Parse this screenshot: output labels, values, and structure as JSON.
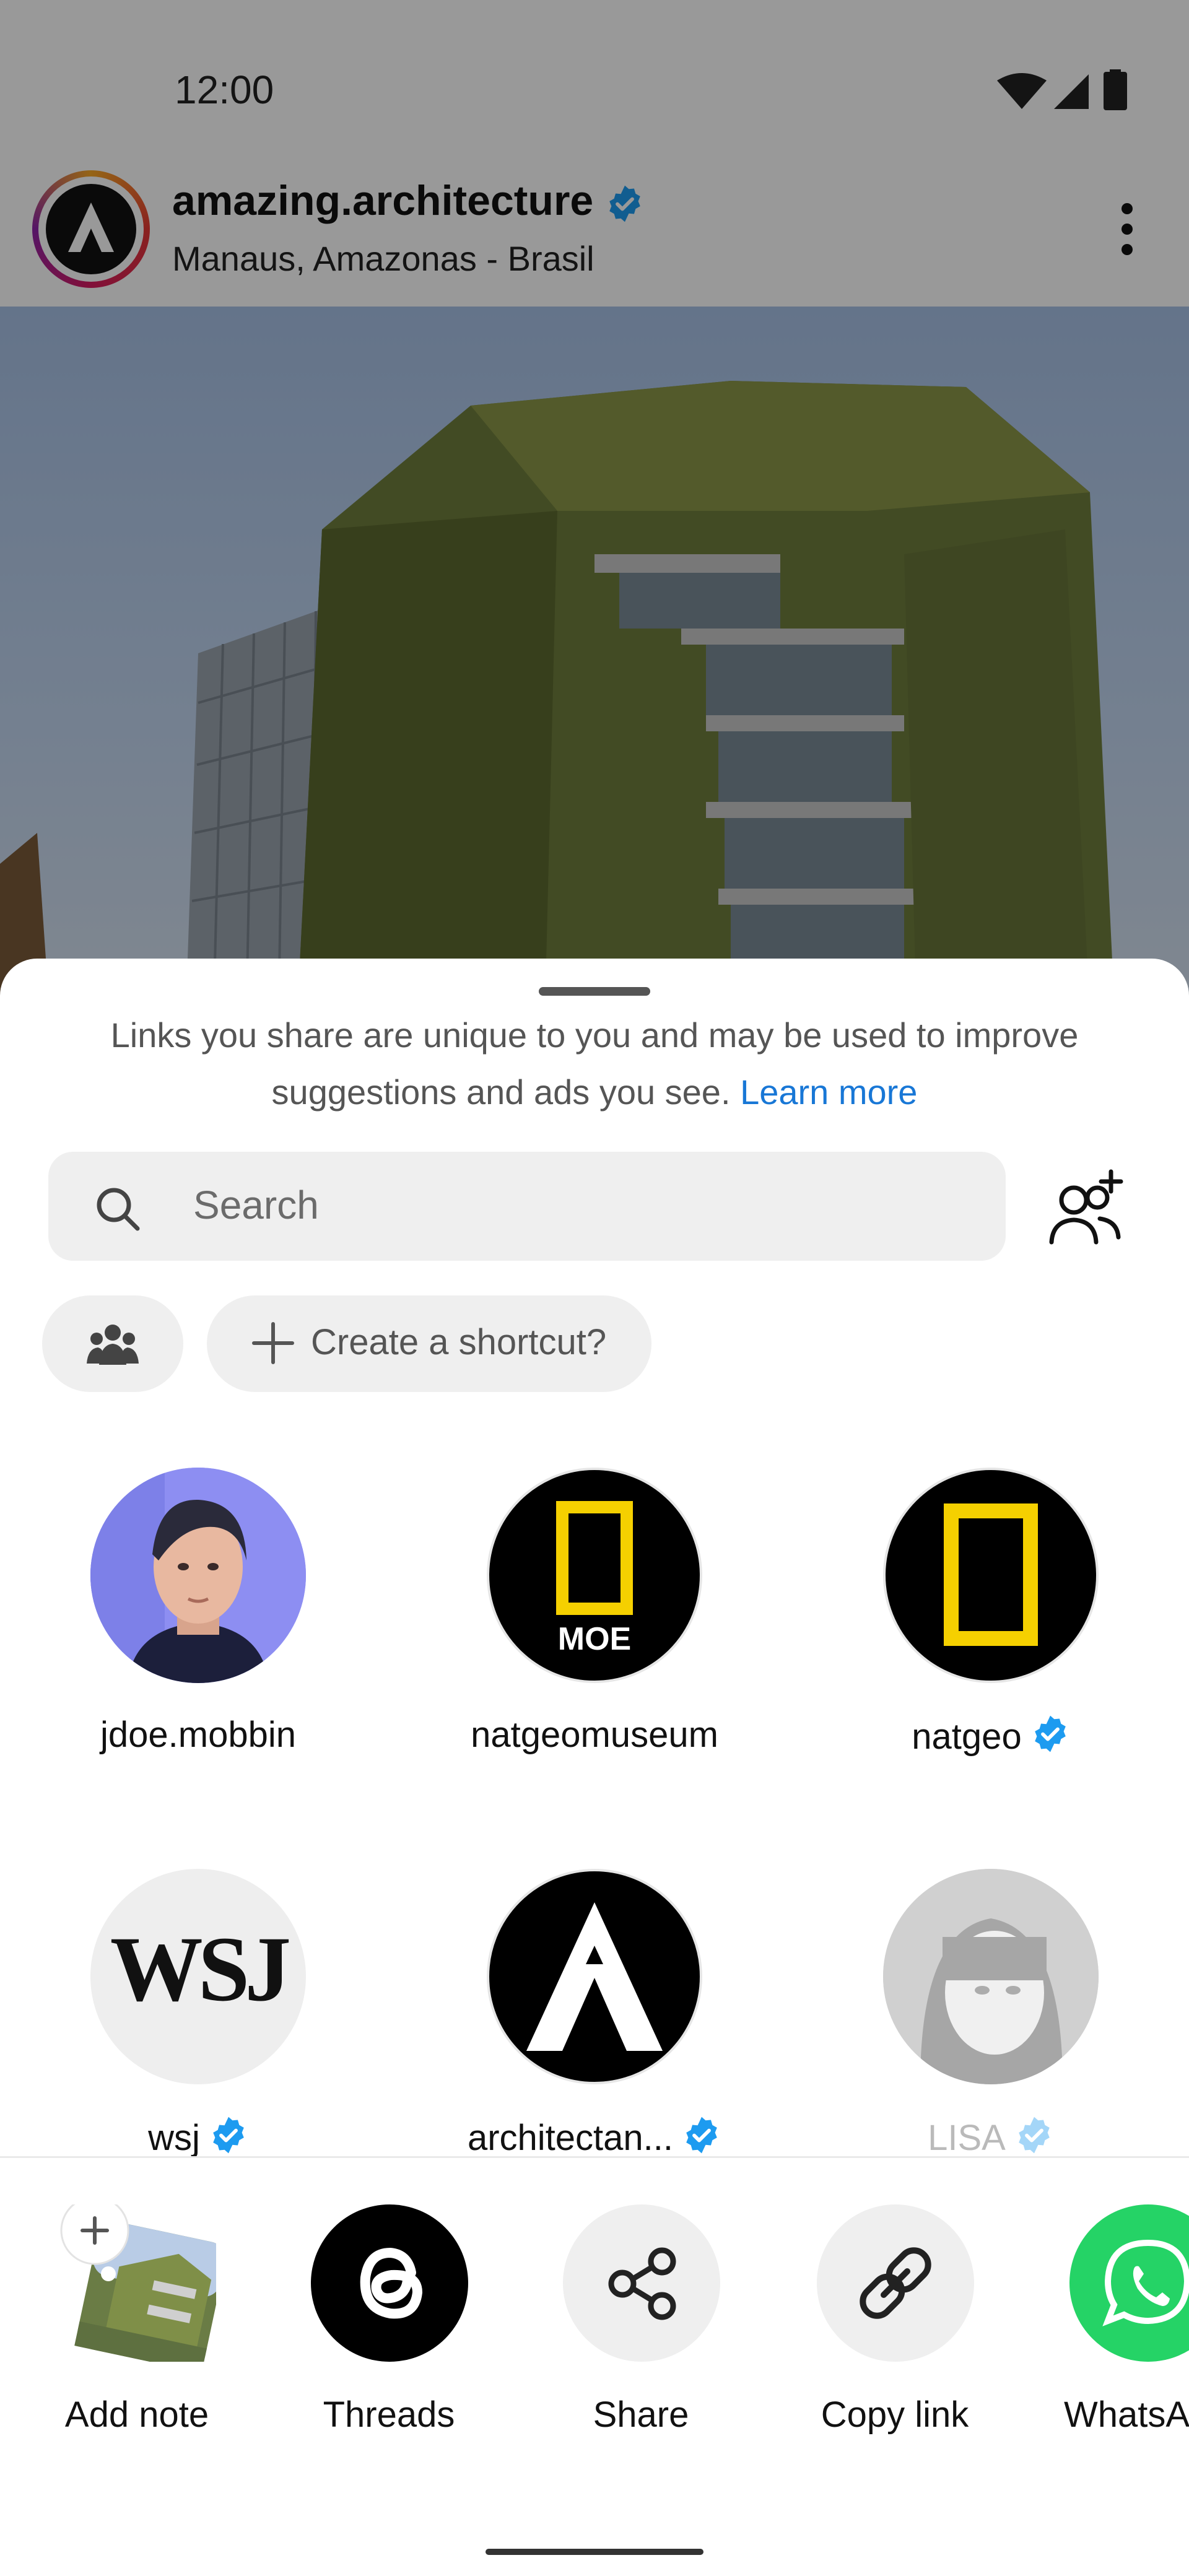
{
  "status_bar": {
    "time": "12:00"
  },
  "post": {
    "account": "amazing.architecture",
    "verified": true,
    "location": "Manaus, Amazonas - Brasil"
  },
  "share_sheet": {
    "disclaimer": "Links you share are unique to you and may be used to improve suggestions and ads you see.",
    "learn_more": "Learn more",
    "search_placeholder": "Search",
    "shortcut_label": "Create a shortcut?",
    "contacts": [
      {
        "name": "jdoe.mobbin",
        "verified": false
      },
      {
        "name": "natgeomuseum",
        "verified": false
      },
      {
        "name": "natgeo",
        "verified": true
      },
      {
        "name": "wsj",
        "verified": true
      },
      {
        "name": "architectan...",
        "verified": true
      },
      {
        "name": "LISA",
        "verified": true
      }
    ],
    "logos": {
      "museum": "MOE",
      "wsj": "WSJ"
    },
    "actions": [
      {
        "label": "Add note",
        "icon": "add-note-icon"
      },
      {
        "label": "Threads",
        "icon": "threads-icon"
      },
      {
        "label": "Share",
        "icon": "share-icon"
      },
      {
        "label": "Copy link",
        "icon": "link-icon"
      },
      {
        "label": "WhatsA",
        "icon": "whatsapp-icon"
      }
    ]
  },
  "colors": {
    "link_blue": "#1877d6",
    "verified_blue": "#1d9bf0",
    "natgeo_yellow": "#f5d000",
    "whatsapp_green": "#25d366",
    "chip_gray": "#efefef"
  }
}
